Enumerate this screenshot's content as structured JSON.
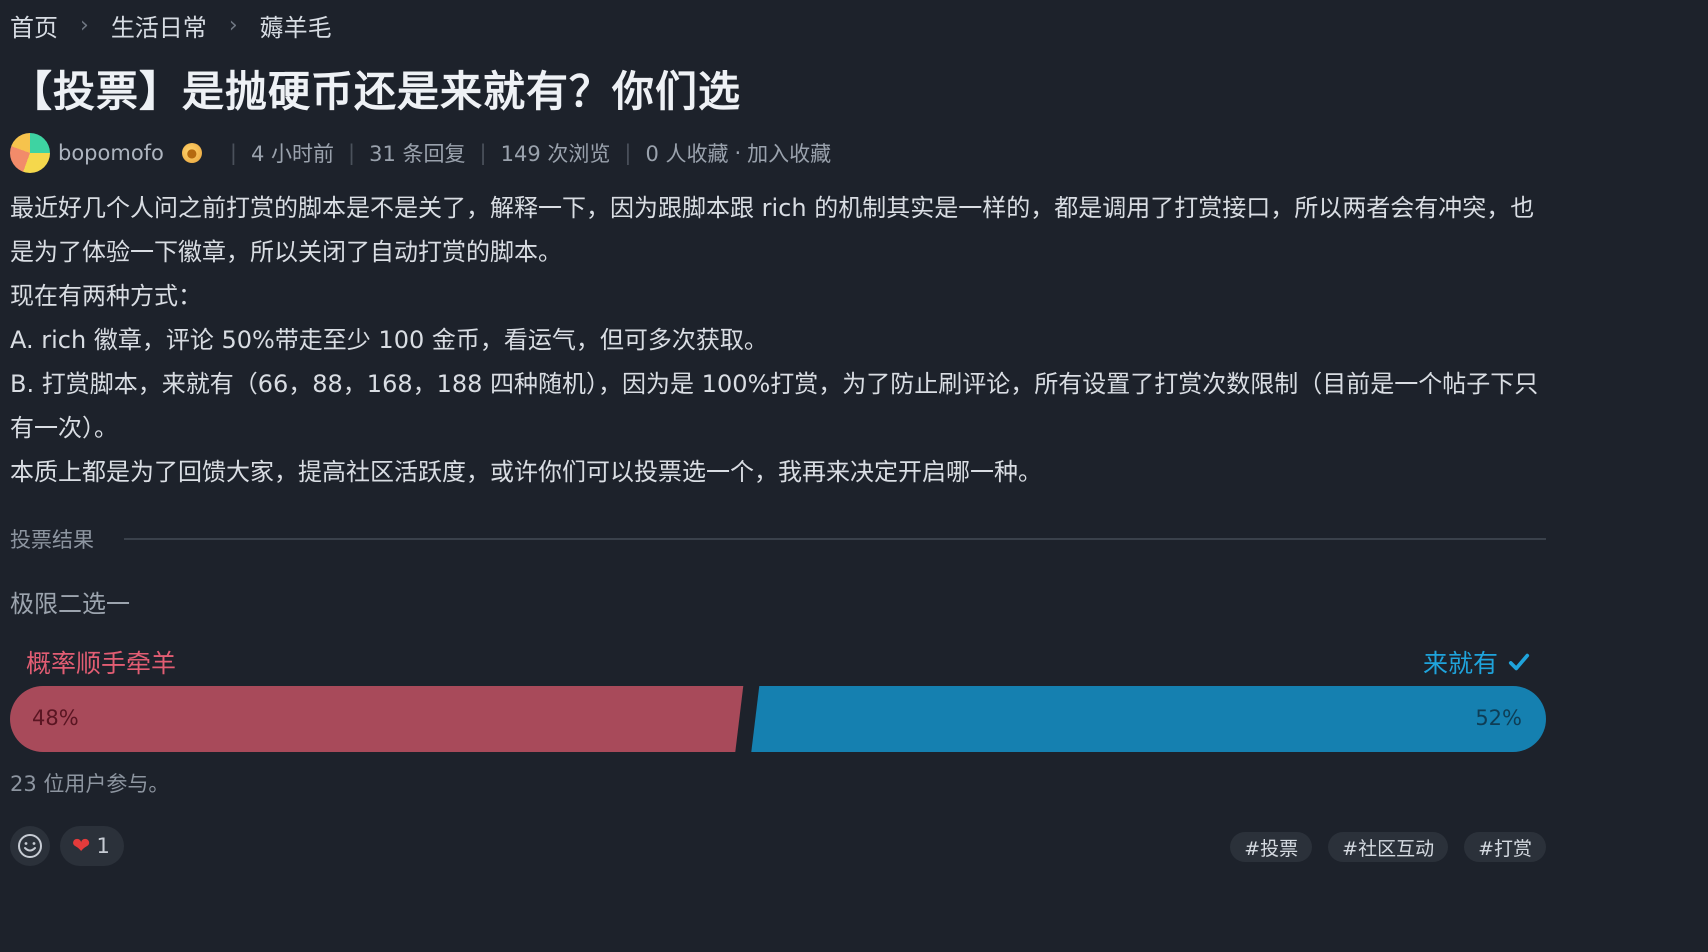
{
  "breadcrumb": {
    "items": [
      "首页",
      "生活日常",
      "薅羊毛"
    ],
    "separator": "›"
  },
  "post": {
    "title": "【投票】是抛硬币还是来就有？你们选",
    "author": "bopomofo",
    "time": "4 小时前",
    "replies": "31 条回复",
    "views": "149 次浏览",
    "favorites": "0 人收藏",
    "favorite_dot": "·",
    "add_favorite": "加入收藏",
    "body": [
      "最近好几个人问之前打赏的脚本是不是关了，解释一下，因为跟脚本跟 rich 的机制其实是一样的，都是调用了打赏接口，所以两者会有冲突，也是为了体验一下徽章，所以关闭了自动打赏的脚本。",
      "现在有两种方式：",
      "A. rich 徽章，评论 50%带走至少 100 金币，看运气，但可多次获取。",
      "B. 打赏脚本，来就有（66，88，168，188 四种随机），因为是 100%打赏，为了防止刷评论，所有设置了打赏次数限制（目前是一个帖子下只有一次）。",
      "本质上都是为了回馈大家，提高社区活跃度，或许你们可以投票选一个，我再来决定开启哪一种。"
    ]
  },
  "poll": {
    "section_label": "投票结果",
    "question": "极限二选一",
    "option_a": {
      "label": "概率顺手牵羊",
      "percent": 48,
      "percent_label": "48%",
      "color": "#a84a5a"
    },
    "option_b": {
      "label": "来就有",
      "percent": 52,
      "percent_label": "52%",
      "color": "#1580b0",
      "selected": true
    },
    "participants": "23 位用户参与。"
  },
  "footer": {
    "emoji_icon": "smiley-icon",
    "like_count": "1",
    "tags": [
      "#投票",
      "#社区互动",
      "#打赏"
    ]
  },
  "colors": {
    "background": "#1d222b",
    "accent_red": "#e25d73",
    "accent_blue": "#1fa4dc"
  }
}
